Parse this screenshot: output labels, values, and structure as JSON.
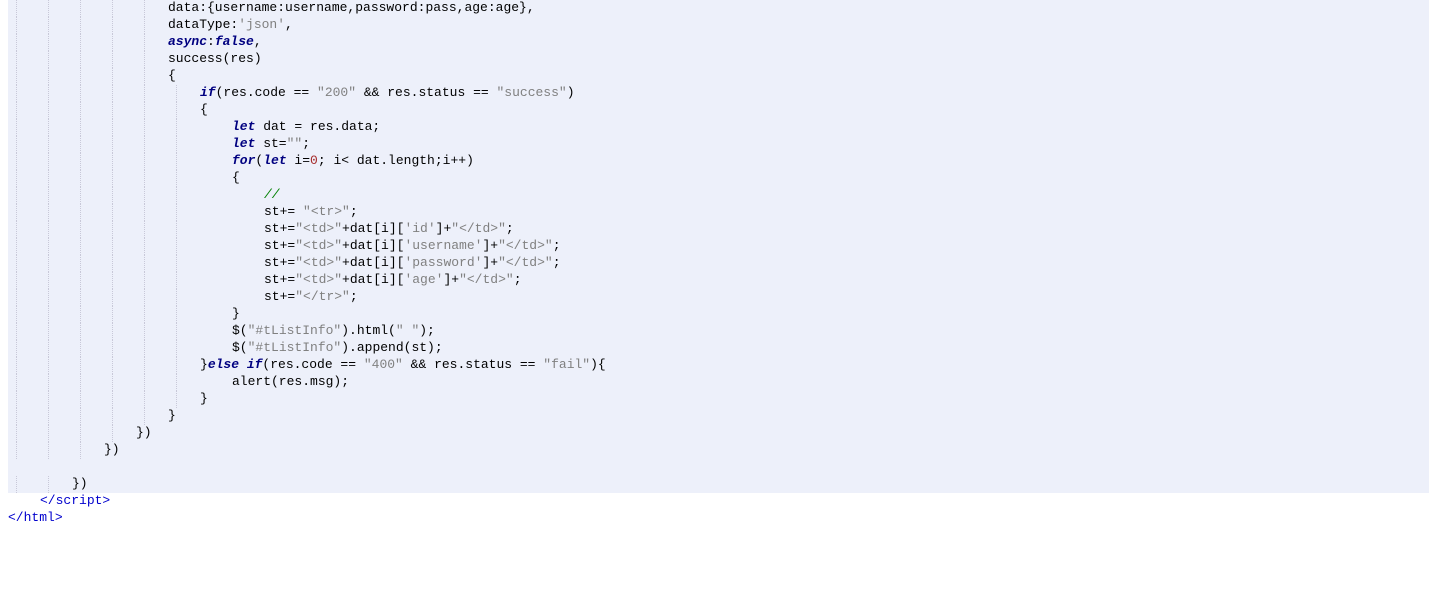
{
  "lines": [
    {
      "indent": 160,
      "bg": "hl",
      "tokens": [
        {
          "t": "data:{username:username,password:pass,age:age},",
          "c": "c-default"
        }
      ]
    },
    {
      "indent": 160,
      "bg": "hl",
      "tokens": [
        {
          "t": "dataType:",
          "c": "c-default"
        },
        {
          "t": "'json'",
          "c": "c-string"
        },
        {
          "t": ",",
          "c": "c-default"
        }
      ]
    },
    {
      "indent": 160,
      "bg": "hl",
      "tokens": [
        {
          "t": "async",
          "c": "c-keyword"
        },
        {
          "t": ":",
          "c": "c-default"
        },
        {
          "t": "false",
          "c": "c-false"
        },
        {
          "t": ",",
          "c": "c-default"
        }
      ]
    },
    {
      "indent": 160,
      "bg": "hl",
      "tokens": [
        {
          "t": "success(res)",
          "c": "c-default"
        }
      ]
    },
    {
      "indent": 160,
      "bg": "hl",
      "tokens": [
        {
          "t": "{",
          "c": "c-default"
        }
      ]
    },
    {
      "indent": 192,
      "bg": "hl",
      "tokens": [
        {
          "t": "if",
          "c": "c-keyword"
        },
        {
          "t": "(res.code == ",
          "c": "c-default"
        },
        {
          "t": "\"200\"",
          "c": "c-string"
        },
        {
          "t": " && res.status == ",
          "c": "c-default"
        },
        {
          "t": "\"success\"",
          "c": "c-string"
        },
        {
          "t": ")",
          "c": "c-default"
        }
      ]
    },
    {
      "indent": 192,
      "bg": "hl",
      "tokens": [
        {
          "t": "{",
          "c": "c-default"
        }
      ]
    },
    {
      "indent": 224,
      "bg": "hl",
      "tokens": [
        {
          "t": "let",
          "c": "c-let"
        },
        {
          "t": " dat = res.data;",
          "c": "c-default"
        }
      ]
    },
    {
      "indent": 224,
      "bg": "hl",
      "tokens": [
        {
          "t": "let",
          "c": "c-let"
        },
        {
          "t": " st=",
          "c": "c-default"
        },
        {
          "t": "\"\"",
          "c": "c-string"
        },
        {
          "t": ";",
          "c": "c-default"
        }
      ]
    },
    {
      "indent": 224,
      "bg": "hl",
      "tokens": [
        {
          "t": "for",
          "c": "c-keyword"
        },
        {
          "t": "(",
          "c": "c-default"
        },
        {
          "t": "let",
          "c": "c-let"
        },
        {
          "t": " i=",
          "c": "c-default"
        },
        {
          "t": "0",
          "c": "c-number"
        },
        {
          "t": "; i< dat.length;i++)",
          "c": "c-default"
        }
      ]
    },
    {
      "indent": 224,
      "bg": "hl",
      "tokens": [
        {
          "t": "{",
          "c": "c-default"
        }
      ]
    },
    {
      "indent": 256,
      "bg": "hl",
      "tokens": [
        {
          "t": "//",
          "c": "c-comment"
        }
      ]
    },
    {
      "indent": 256,
      "bg": "hl",
      "tokens": [
        {
          "t": "st+= ",
          "c": "c-default"
        },
        {
          "t": "\"<tr>\"",
          "c": "c-string"
        },
        {
          "t": ";",
          "c": "c-default"
        }
      ]
    },
    {
      "indent": 256,
      "bg": "hl",
      "tokens": [
        {
          "t": "st+=",
          "c": "c-default"
        },
        {
          "t": "\"<td>\"",
          "c": "c-string"
        },
        {
          "t": "+dat[i][",
          "c": "c-default"
        },
        {
          "t": "'id'",
          "c": "c-string"
        },
        {
          "t": "]+",
          "c": "c-default"
        },
        {
          "t": "\"</td>\"",
          "c": "c-string"
        },
        {
          "t": ";",
          "c": "c-default"
        }
      ]
    },
    {
      "indent": 256,
      "bg": "hl",
      "tokens": [
        {
          "t": "st+=",
          "c": "c-default"
        },
        {
          "t": "\"<td>\"",
          "c": "c-string"
        },
        {
          "t": "+dat[i][",
          "c": "c-default"
        },
        {
          "t": "'username'",
          "c": "c-string"
        },
        {
          "t": "]+",
          "c": "c-default"
        },
        {
          "t": "\"</td>\"",
          "c": "c-string"
        },
        {
          "t": ";",
          "c": "c-default"
        }
      ]
    },
    {
      "indent": 256,
      "bg": "hl",
      "tokens": [
        {
          "t": "st+=",
          "c": "c-default"
        },
        {
          "t": "\"<td>\"",
          "c": "c-string"
        },
        {
          "t": "+dat[i][",
          "c": "c-default"
        },
        {
          "t": "'password'",
          "c": "c-string"
        },
        {
          "t": "]+",
          "c": "c-default"
        },
        {
          "t": "\"</td>\"",
          "c": "c-string"
        },
        {
          "t": ";",
          "c": "c-default"
        }
      ]
    },
    {
      "indent": 256,
      "bg": "hl",
      "tokens": [
        {
          "t": "st+=",
          "c": "c-default"
        },
        {
          "t": "\"<td>\"",
          "c": "c-string"
        },
        {
          "t": "+dat[i][",
          "c": "c-default"
        },
        {
          "t": "'age'",
          "c": "c-string"
        },
        {
          "t": "]+",
          "c": "c-default"
        },
        {
          "t": "\"</td>\"",
          "c": "c-string"
        },
        {
          "t": ";",
          "c": "c-default"
        }
      ]
    },
    {
      "indent": 256,
      "bg": "hl",
      "tokens": [
        {
          "t": "st+=",
          "c": "c-default"
        },
        {
          "t": "\"</tr>\"",
          "c": "c-string"
        },
        {
          "t": ";",
          "c": "c-default"
        }
      ]
    },
    {
      "indent": 224,
      "bg": "hl",
      "tokens": [
        {
          "t": "}",
          "c": "c-default"
        }
      ]
    },
    {
      "indent": 224,
      "bg": "hl",
      "tokens": [
        {
          "t": "$(",
          "c": "c-default"
        },
        {
          "t": "\"#tListInfo\"",
          "c": "c-string"
        },
        {
          "t": ").html(",
          "c": "c-default"
        },
        {
          "t": "\" \"",
          "c": "c-string"
        },
        {
          "t": ");",
          "c": "c-default"
        }
      ]
    },
    {
      "indent": 224,
      "bg": "hl",
      "tokens": [
        {
          "t": "$(",
          "c": "c-default"
        },
        {
          "t": "\"#tListInfo\"",
          "c": "c-string"
        },
        {
          "t": ").append(st);",
          "c": "c-default"
        }
      ]
    },
    {
      "indent": 192,
      "bg": "hl",
      "tokens": [
        {
          "t": "}",
          "c": "c-default"
        },
        {
          "t": "else if",
          "c": "c-keyword"
        },
        {
          "t": "(res.code == ",
          "c": "c-default"
        },
        {
          "t": "\"400\"",
          "c": "c-string"
        },
        {
          "t": " && res.status == ",
          "c": "c-default"
        },
        {
          "t": "\"fail\"",
          "c": "c-string"
        },
        {
          "t": "){",
          "c": "c-default"
        }
      ]
    },
    {
      "indent": 224,
      "bg": "hl",
      "tokens": [
        {
          "t": "alert(res.msg);",
          "c": "c-default"
        }
      ]
    },
    {
      "indent": 192,
      "bg": "hl",
      "tokens": [
        {
          "t": "}",
          "c": "c-default"
        }
      ]
    },
    {
      "indent": 160,
      "bg": "hl",
      "tokens": [
        {
          "t": "}",
          "c": "c-default"
        }
      ]
    },
    {
      "indent": 128,
      "bg": "hl",
      "tokens": [
        {
          "t": "})",
          "c": "c-default"
        }
      ]
    },
    {
      "indent": 96,
      "bg": "hl",
      "tokens": [
        {
          "t": "})",
          "c": "c-default"
        }
      ]
    },
    {
      "indent": 0,
      "bg": "hl",
      "tokens": [
        {
          "t": "",
          "c": "c-default"
        }
      ]
    },
    {
      "indent": 64,
      "bg": "hl",
      "tokens": [
        {
          "t": "})",
          "c": "c-default"
        }
      ]
    },
    {
      "indent": 32,
      "bg": "plain",
      "tokens": [
        {
          "t": "</",
          "c": "c-tag"
        },
        {
          "t": "script",
          "c": "c-tag"
        },
        {
          "t": ">",
          "c": "c-tag"
        }
      ]
    },
    {
      "indent": 0,
      "bg": "plain",
      "tokens": [
        {
          "t": "</",
          "c": "c-tag"
        },
        {
          "t": "html",
          "c": "c-tag"
        },
        {
          "t": ">",
          "c": "c-tag"
        }
      ]
    }
  ],
  "guide_positions": [
    8,
    40,
    72,
    104,
    136,
    168
  ]
}
